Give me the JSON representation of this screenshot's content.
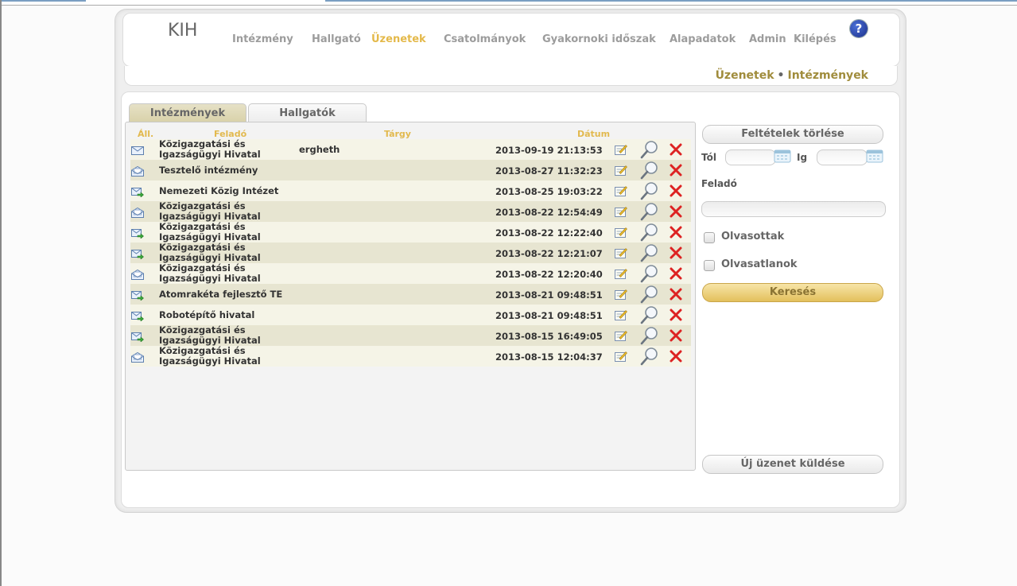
{
  "app": {
    "logo": "KIH"
  },
  "nav": [
    {
      "label": "Intézmény",
      "active": false
    },
    {
      "label": "Hallgató",
      "active": false
    },
    {
      "label": "Üzenetek",
      "active": true
    },
    {
      "label": "Csatolmányok",
      "active": false
    },
    {
      "label": "Gyakornoki időszak",
      "active": false
    },
    {
      "label": "Alapadatok",
      "active": false
    },
    {
      "label": "Admin",
      "active": false
    },
    {
      "label": "Kilépés",
      "active": false
    }
  ],
  "help": {
    "label": "?",
    "icon": "help-icon"
  },
  "breadcrumb": {
    "first": "Üzenetek",
    "separator": "•",
    "second": "Intézmények"
  },
  "tabs": [
    {
      "label": "Intézmények",
      "active": true
    },
    {
      "label": "Hallgatók",
      "active": false
    }
  ],
  "table": {
    "columns": {
      "status": "Áll.",
      "sender": "Feladó",
      "subject": "Tárgy",
      "date": "Dátum"
    },
    "rows": [
      {
        "status": "unread",
        "sender": "Közigazgatási és Igazságügyi Hivatal",
        "subject": "ergheth",
        "date": "2013-09-19 21:13:53"
      },
      {
        "status": "read",
        "sender": "Tesztelő intézmény",
        "subject": "",
        "date": "2013-08-27 11:32:23"
      },
      {
        "status": "replied",
        "sender": "Nemezeti Közig Intézet",
        "subject": "",
        "date": "2013-08-25 19:03:22"
      },
      {
        "status": "read",
        "sender": "Közigazgatási és Igazságügyi Hivatal",
        "subject": "",
        "date": "2013-08-22 12:54:49"
      },
      {
        "status": "replied",
        "sender": "Közigazgatási és Igazságügyi Hivatal",
        "subject": "",
        "date": "2013-08-22 12:22:40"
      },
      {
        "status": "replied",
        "sender": "Közigazgatási és Igazságügyi Hivatal",
        "subject": "",
        "date": "2013-08-22 12:21:07"
      },
      {
        "status": "read",
        "sender": "Közigazgatási és Igazságügyi Hivatal",
        "subject": "",
        "date": "2013-08-22 12:20:40"
      },
      {
        "status": "replied",
        "sender": "Atomrakéta fejlesztő TE",
        "subject": "",
        "date": "2013-08-21 09:48:51"
      },
      {
        "status": "replied",
        "sender": "Robotépítő hivatal",
        "subject": "",
        "date": "2013-08-21 09:48:51"
      },
      {
        "status": "replied",
        "sender": "Közigazgatási és Igazságügyi Hivatal",
        "subject": "",
        "date": "2013-08-15 16:49:05"
      },
      {
        "status": "read",
        "sender": "Közigazgatási és Igazságügyi Hivatal",
        "subject": "",
        "date": "2013-08-15 12:04:37"
      }
    ]
  },
  "filters": {
    "clear_label": "Feltételek törlése",
    "from_label": "Tól",
    "to_label": "Ig",
    "from_value": "",
    "to_value": "",
    "sender_label": "Feladó",
    "sender_value": "",
    "read_label": "Olvasottak",
    "unread_label": "Olvasatlanok",
    "read_checked": false,
    "unread_checked": false,
    "search_label": "Keresés"
  },
  "new_message_label": "Új üzenet küldése",
  "colors": {
    "accent": "#e4b94a",
    "breadcrumb": "#a08c3c",
    "delete": "#dd2222"
  }
}
